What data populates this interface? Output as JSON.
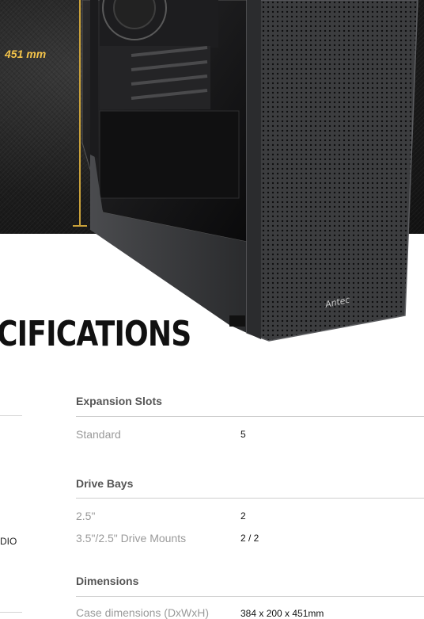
{
  "hero": {
    "dimension_label": "451 mm",
    "brand_mark": "Antec"
  },
  "heading": "CIFICATIONS",
  "left_column": {
    "partial_text": "DIO"
  },
  "sections": [
    {
      "title": "Expansion Slots",
      "rows": [
        {
          "label": "Standard",
          "value": "5"
        }
      ]
    },
    {
      "title": "Drive Bays",
      "rows": [
        {
          "label": "2.5\"",
          "value": "2"
        },
        {
          "label": "3.5\"/2.5\" Drive Mounts",
          "value": "2 / 2"
        }
      ]
    },
    {
      "title": "Dimensions",
      "rows": [
        {
          "label": "Case dimensions (DxWxH)",
          "value": "384 x 200 x 451mm"
        }
      ]
    }
  ]
}
